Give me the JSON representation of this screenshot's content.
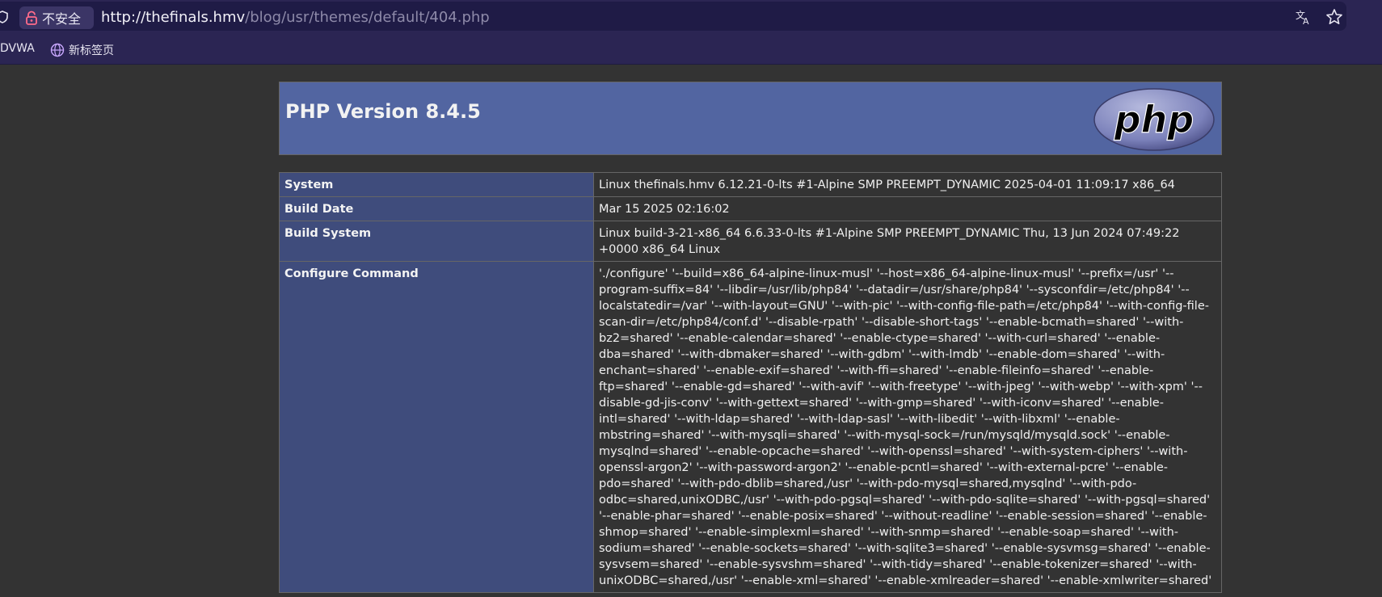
{
  "browser": {
    "security_label": "不安全",
    "url_host": "http://thefinals.hmv",
    "url_path": "/blog/usr/themes/default/404.php",
    "bookmarks": [
      {
        "label": "DVWA"
      },
      {
        "label": "新标签页"
      }
    ]
  },
  "phpinfo": {
    "title": "PHP Version 8.4.5",
    "logo_text": "php",
    "rows": [
      {
        "label": "System",
        "value": "Linux thefinals.hmv 6.12.21-0-lts #1-Alpine SMP PREEMPT_DYNAMIC 2025-04-01 11:09:17 x86_64"
      },
      {
        "label": "Build Date",
        "value": "Mar 15 2025 02:16:02"
      },
      {
        "label": "Build System",
        "value": "Linux build-3-21-x86_64 6.6.33-0-lts #1-Alpine SMP PREEMPT_DYNAMIC Thu, 13 Jun 2024 07:49:22 +0000 x86_64 Linux"
      },
      {
        "label": "Configure Command",
        "value": "'./configure' '--build=x86_64-alpine-linux-musl' '--host=x86_64-alpine-linux-musl' '--prefix=/usr' '--program-suffix=84' '--libdir=/usr/lib/php84' '--datadir=/usr/share/php84' '--sysconfdir=/etc/php84' '--localstatedir=/var' '--with-layout=GNU' '--with-pic' '--with-config-file-path=/etc/php84' '--with-config-file-scan-dir=/etc/php84/conf.d' '--disable-rpath' '--disable-short-tags' '--enable-bcmath=shared' '--with-bz2=shared' '--enable-calendar=shared' '--enable-ctype=shared' '--with-curl=shared' '--enable-dba=shared' '--with-dbmaker=shared' '--with-gdbm' '--with-lmdb' '--enable-dom=shared' '--with-enchant=shared' '--enable-exif=shared' '--with-ffi=shared' '--enable-fileinfo=shared' '--enable-ftp=shared' '--enable-gd=shared' '--with-avif' '--with-freetype' '--with-jpeg' '--with-webp' '--with-xpm' '--disable-gd-jis-conv' '--with-gettext=shared' '--with-gmp=shared' '--with-iconv=shared' '--enable-intl=shared' '--with-ldap=shared' '--with-ldap-sasl' '--with-libedit' '--with-libxml' '--enable-mbstring=shared' '--with-mysqli=shared' '--with-mysql-sock=/run/mysqld/mysqld.sock' '--enable-mysqlnd=shared' '--enable-opcache=shared' '--with-openssl=shared' '--with-system-ciphers' '--with-openssl-argon2' '--with-password-argon2' '--enable-pcntl=shared' '--with-external-pcre' '--enable-pdo=shared' '--with-pdo-dblib=shared,/usr' '--with-pdo-mysql=shared,mysqlnd' '--with-pdo-odbc=shared,unixODBC,/usr' '--with-pdo-pgsql=shared' '--with-pdo-sqlite=shared' '--with-pgsql=shared' '--enable-phar=shared' '--enable-posix=shared' '--without-readline' '--enable-session=shared' '--enable-shmop=shared' '--enable-simplexml=shared' '--with-snmp=shared' '--enable-soap=shared' '--with-sodium=shared' '--enable-sockets=shared' '--with-sqlite3=shared' '--enable-sysvmsg=shared' '--enable-sysvsem=shared' '--enable-sysvshm=shared' '--with-tidy=shared' '--enable-tokenizer=shared' '--with-unixODBC=shared,/usr' '--enable-xml=shared' '--enable-xmlreader=shared' '--enable-xmlwriter=shared'"
      }
    ]
  },
  "colors": {
    "chrome": "#2b2553",
    "header": "#5265a1",
    "label_cell": "#3f4c7c",
    "page_bg": "#333333"
  }
}
